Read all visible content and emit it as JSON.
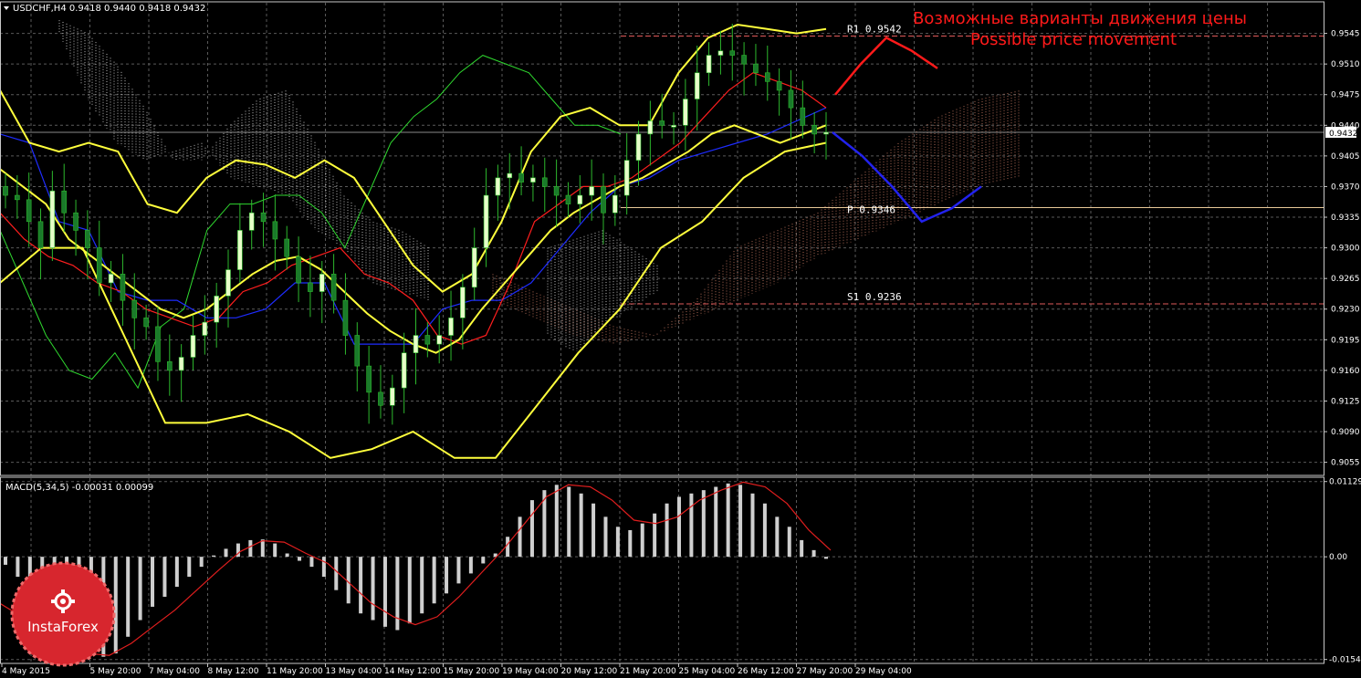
{
  "colors": {
    "background": "#000000",
    "grid": "#5a5a5a",
    "frame": "#c8c8c8",
    "bull_candle": "#e6ffc8",
    "bear_candle": "#1a7a2a",
    "wick": "#2db82d",
    "kijun": "#ff1e1e",
    "tenkan": "#1e2cff",
    "chikou": "#2fd82f",
    "bands": "#ffff3c",
    "cloud_a": "#e8e8e8",
    "cloud_b": "#d8826a",
    "forecast_up": "#ff1a1a",
    "forecast_down": "#2222ee",
    "pivot_pp": "#e8c898",
    "pivot_rs": "#e05a5a",
    "macd_hist": "#cfcfcf",
    "macd_signal": "#e01e1e",
    "annotation": "#ff1a1a",
    "label_text": "#ffffff",
    "badge": "#d7262e"
  },
  "header": {
    "symbol_info": "USDCHF,H4  0.9418 0.9440 0.9418 0.9432",
    "macd_info": "MACD(5,34,5) -0.00031 0.00099"
  },
  "annotations": {
    "ru": "Возможные варианты движения цены",
    "en": "Possible price movement"
  },
  "logo": {
    "text": "InstaForex",
    "icon": "gear-icon"
  },
  "chart_data": [
    {
      "type": "candlestick",
      "symbol": "USDCHF",
      "timeframe": "H4",
      "ohlc_now": {
        "open": 0.9418,
        "high": 0.944,
        "low": 0.9418,
        "close": 0.9432
      },
      "ylim": [
        0.904,
        0.958
      ],
      "y_ticks": [
        0.9545,
        0.951,
        0.9475,
        0.944,
        0.9405,
        0.937,
        0.9335,
        0.93,
        0.9265,
        0.923,
        0.9195,
        0.916,
        0.9125,
        0.909,
        0.9055
      ],
      "current_price": 0.9432,
      "x_labels": [
        "4 May 2015",
        "5 May 20:00",
        "7 May 04:00",
        "8 May 12:00",
        "11 May 20:00",
        "13 May 04:00",
        "14 May 12:00",
        "15 May 20:00",
        "19 May 04:00",
        "20 May 12:00",
        "21 May 20:00",
        "25 May 04:00",
        "26 May 12:00",
        "27 May 20:00",
        "29 May 04:00"
      ],
      "pivots": [
        {
          "label": "R1",
          "value": 0.9542
        },
        {
          "label": "P",
          "value": 0.9346
        },
        {
          "label": "S1",
          "value": 0.9236
        }
      ],
      "series": [
        {
          "kind": "price",
          "values": [
            0.936,
            0.9355,
            0.933,
            0.93,
            0.9365,
            0.934,
            0.932,
            0.93,
            0.926,
            0.927,
            0.924,
            0.922,
            0.921,
            0.917,
            0.916,
            0.9175,
            0.92,
            0.9215,
            0.9245,
            0.9275,
            0.932,
            0.934,
            0.933,
            0.931,
            0.929,
            0.926,
            0.925,
            0.927,
            0.924,
            0.92,
            0.9165,
            0.9135,
            0.912,
            0.914,
            0.918,
            0.92,
            0.919,
            0.92,
            0.922,
            0.9255,
            0.93,
            0.936,
            0.938,
            0.9385,
            0.9375,
            0.938,
            0.937,
            0.936,
            0.935,
            0.936,
            0.937,
            0.934,
            0.936,
            0.94,
            0.943,
            0.9445,
            0.944,
            0.944,
            0.947,
            0.95,
            0.952,
            0.9525,
            0.952,
            0.951,
            0.95,
            0.949,
            0.948,
            0.946,
            0.944,
            0.943,
            0.9432
          ]
        },
        {
          "kind": "bands_mid",
          "values": [
            0.939,
            0.937,
            0.935,
            0.931,
            0.929,
            0.927,
            0.925,
            0.923,
            0.922,
            0.923,
            0.925,
            0.927,
            0.9285,
            0.929,
            0.9275,
            0.925,
            0.9225,
            0.9205,
            0.919,
            0.918,
            0.9195,
            0.923,
            0.926,
            0.929,
            0.932,
            0.934,
            0.9355,
            0.937,
            0.938,
            0.9395,
            0.941,
            0.943,
            0.944,
            0.943,
            0.942,
            0.943,
            0.944
          ]
        },
        {
          "kind": "bands_upper",
          "values": [
            0.948,
            0.942,
            0.941,
            0.942,
            0.941,
            0.935,
            0.934,
            0.938,
            0.94,
            0.9395,
            0.938,
            0.94,
            0.938,
            0.933,
            0.928,
            0.925,
            0.927,
            0.933,
            0.941,
            0.945,
            0.946,
            0.944,
            0.944,
            0.95,
            0.954,
            0.9555,
            0.955,
            0.9545,
            0.955
          ]
        },
        {
          "kind": "bands_lower",
          "values": [
            0.926,
            0.93,
            0.93,
            0.92,
            0.91,
            0.91,
            0.911,
            0.909,
            0.906,
            0.907,
            0.909,
            0.906,
            0.906,
            0.912,
            0.918,
            0.923,
            0.93,
            0.933,
            0.938,
            0.941,
            0.942
          ]
        },
        {
          "kind": "kijun",
          "values": [
            0.934,
            0.931,
            0.929,
            0.928,
            0.926,
            0.925,
            0.923,
            0.922,
            0.921,
            0.922,
            0.925,
            0.926,
            0.928,
            0.929,
            0.93,
            0.927,
            0.926,
            0.924,
            0.92,
            0.919,
            0.92,
            0.926,
            0.933,
            0.935,
            0.937,
            0.937,
            0.938,
            0.94,
            0.942,
            0.945,
            0.948,
            0.95,
            0.949,
            0.948,
            0.946
          ]
        },
        {
          "kind": "tenkan",
          "values": [
            0.943,
            0.942,
            0.933,
            0.932,
            0.925,
            0.924,
            0.924,
            0.922,
            0.922,
            0.923,
            0.926,
            0.926,
            0.919,
            0.919,
            0.919,
            0.923,
            0.924,
            0.924,
            0.926,
            0.93,
            0.934,
            0.937,
            0.938,
            0.94,
            0.941,
            0.942,
            0.943,
            0.9445,
            0.946
          ]
        },
        {
          "kind": "chikou",
          "values": [
            0.932,
            0.926,
            0.92,
            0.916,
            0.915,
            0.918,
            0.914,
            0.921,
            0.923,
            0.932,
            0.935,
            0.935,
            0.936,
            0.936,
            0.934,
            0.93,
            0.936,
            0.942,
            0.945,
            0.947,
            0.95,
            0.952,
            0.951,
            0.95,
            0.947,
            0.944,
            0.944,
            0.943
          ]
        },
        {
          "kind": "forecast_up",
          "values": [
            0.9475,
            0.951,
            0.954,
            0.9525,
            0.9505
          ]
        },
        {
          "kind": "forecast_down",
          "values": [
            0.9432,
            0.9405,
            0.937,
            0.933,
            0.9345,
            0.937
          ]
        }
      ]
    },
    {
      "type": "bar",
      "name": "MACD(5,34,5)",
      "ylim": [
        -0.016,
        0.0118
      ],
      "y_ticks": [
        0.01129,
        0.0,
        -0.01541
      ],
      "y_tick_labels": [
        "0.01129",
        "0.00",
        "-0.01541"
      ],
      "values": [
        -0.0012,
        -0.003,
        -0.005,
        -0.007,
        -0.009,
        -0.0105,
        -0.012,
        -0.0135,
        -0.015,
        -0.0145,
        -0.012,
        -0.0095,
        -0.0075,
        -0.006,
        -0.0045,
        -0.003,
        -0.0015,
        0.0002,
        0.0012,
        0.002,
        0.0025,
        0.0026,
        0.002,
        0.0005,
        -0.0006,
        -0.0015,
        -0.003,
        -0.005,
        -0.007,
        -0.0085,
        -0.0095,
        -0.0105,
        -0.011,
        -0.01,
        -0.0085,
        -0.007,
        -0.0055,
        -0.004,
        -0.0025,
        -0.001,
        0.0005,
        0.003,
        0.006,
        0.0085,
        0.01,
        0.0108,
        0.0105,
        0.0095,
        0.008,
        0.006,
        0.0045,
        0.004,
        0.005,
        0.0065,
        0.008,
        0.009,
        0.0095,
        0.01,
        0.0105,
        0.011,
        0.0108,
        0.0095,
        0.008,
        0.006,
        0.0045,
        0.0025,
        0.001,
        -0.0003
      ],
      "signal": [
        -0.007,
        -0.009,
        -0.011,
        -0.013,
        -0.0145,
        -0.0148,
        -0.013,
        -0.0105,
        -0.008,
        -0.005,
        -0.002,
        0.0008,
        0.0024,
        0.0022,
        0.0005,
        -0.001,
        -0.004,
        -0.007,
        -0.009,
        -0.0102,
        -0.009,
        -0.006,
        -0.0025,
        0.001,
        0.005,
        0.009,
        0.0108,
        0.0105,
        0.0085,
        0.0055,
        0.005,
        0.006,
        0.0085,
        0.01,
        0.0112,
        0.0105,
        0.008,
        0.004,
        0.001
      ]
    }
  ]
}
